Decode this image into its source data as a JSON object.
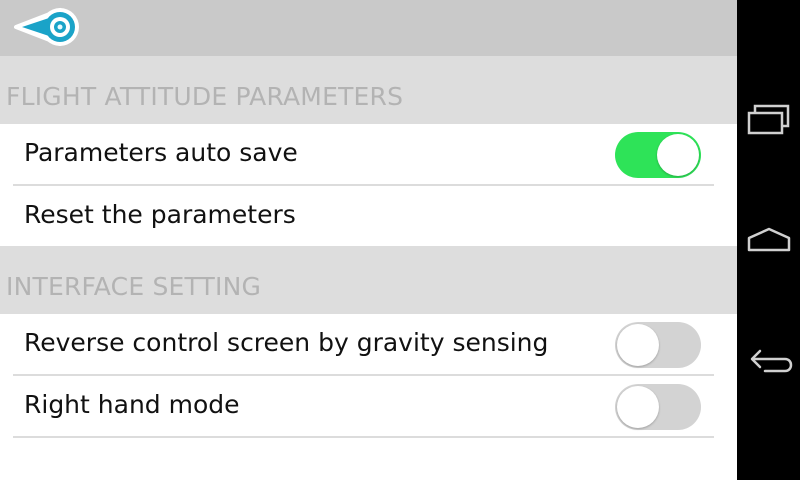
{
  "sections": {
    "flight": {
      "header": "FLIGHT ATTITUDE PARAMETERS",
      "auto_save": {
        "label": "Parameters auto save",
        "enabled": true
      },
      "reset": {
        "label": "Reset the parameters"
      }
    },
    "interface": {
      "header": "INTERFACE SETTING",
      "gravity": {
        "label": "Reverse control screen by gravity sensing",
        "enabled": false
      },
      "right_hand": {
        "label": "Right hand mode",
        "enabled": false
      }
    }
  },
  "colors": {
    "toggle_on": "#2ee358",
    "toggle_off": "#d3d3d3",
    "back_icon": "#1aa3c8",
    "section_header_bg": "#dddddd",
    "topbar_bg": "#c9c9c9"
  },
  "icons": {
    "back": "back-arrow-icon",
    "recents": "recent-apps-icon",
    "home": "home-icon",
    "back_nav": "back-nav-icon"
  }
}
